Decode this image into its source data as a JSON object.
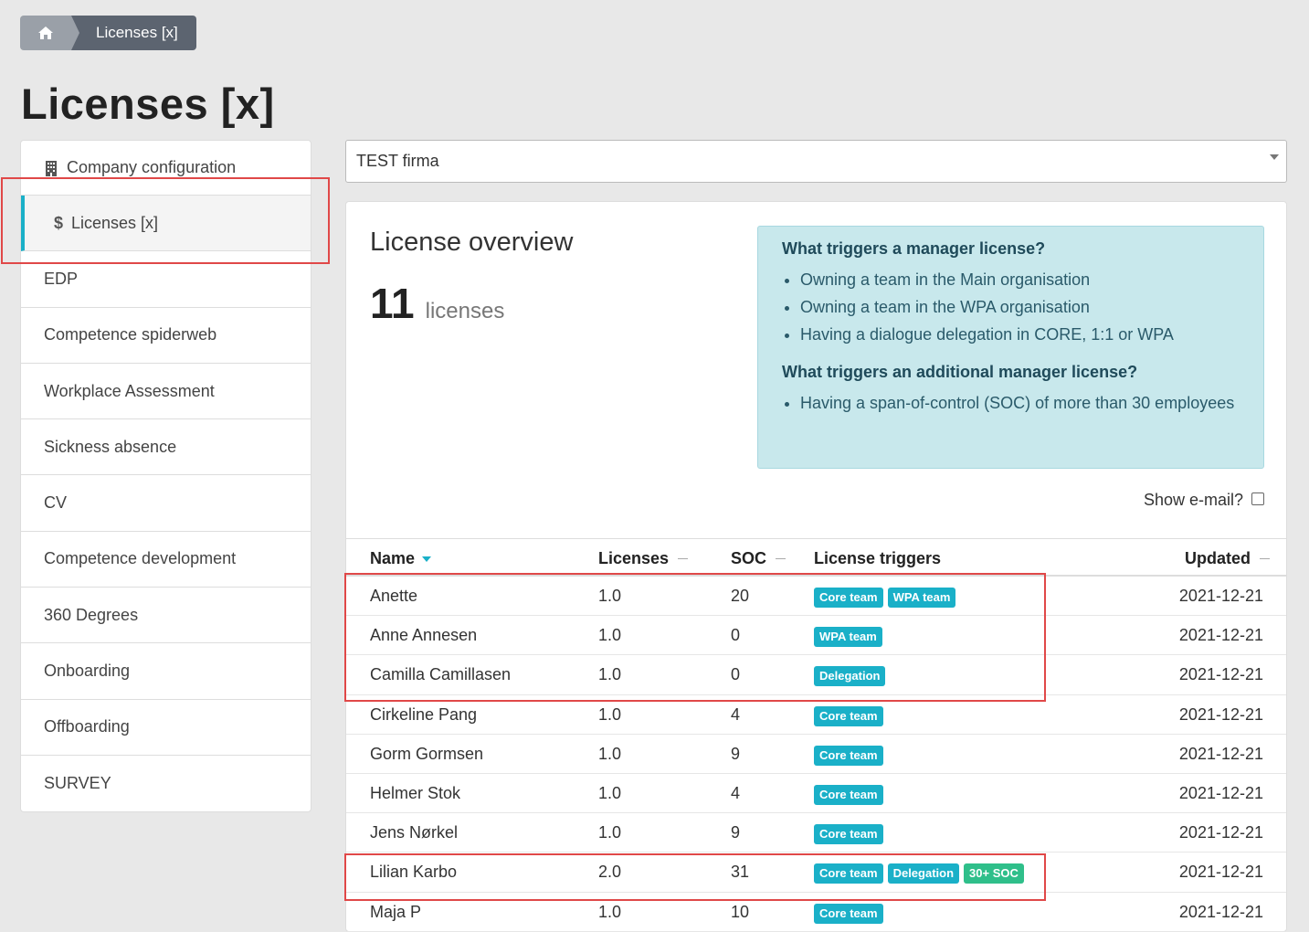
{
  "breadcrumb": {
    "home_icon": "home-icon",
    "current": "Licenses [x]"
  },
  "page_title": "Licenses [x]",
  "sidebar": {
    "items": [
      {
        "label": "Company configuration",
        "icon": "building-icon"
      },
      {
        "label": "Licenses [x]",
        "icon": "dollar-icon",
        "active": true
      },
      {
        "label": "EDP"
      },
      {
        "label": "Competence spiderweb"
      },
      {
        "label": "Workplace Assessment"
      },
      {
        "label": "Sickness absence"
      },
      {
        "label": "CV"
      },
      {
        "label": "Competence development"
      },
      {
        "label": "360 Degrees"
      },
      {
        "label": "Onboarding"
      },
      {
        "label": "Offboarding"
      },
      {
        "label": "SURVEY"
      }
    ]
  },
  "company_select": {
    "value": "TEST firma"
  },
  "overview": {
    "title": "License overview",
    "count": "11",
    "count_label": "licenses"
  },
  "info": {
    "heading1": "What triggers a manager license?",
    "list1": [
      "Owning a team in the Main organisation",
      "Owning a team in the WPA organisation",
      "Having a dialogue delegation in CORE, 1:1 or WPA"
    ],
    "heading2": "What triggers an additional manager license?",
    "list2": [
      "Having a span-of-control (SOC) of more than 30 employees"
    ]
  },
  "show_email": {
    "label": "Show e-mail?",
    "checked": false
  },
  "table": {
    "columns": {
      "name": "Name",
      "licenses": "Licenses",
      "soc": "SOC",
      "triggers": "License triggers",
      "updated": "Updated"
    },
    "rows": [
      {
        "name": "Anette",
        "licenses": "1.0",
        "soc": "20",
        "triggers": [
          "Core team",
          "WPA team"
        ],
        "updated": "2021-12-21"
      },
      {
        "name": "Anne Annesen",
        "licenses": "1.0",
        "soc": "0",
        "triggers": [
          "WPA team"
        ],
        "updated": "2021-12-21"
      },
      {
        "name": "Camilla Camillasen",
        "licenses": "1.0",
        "soc": "0",
        "triggers": [
          "Delegation"
        ],
        "updated": "2021-12-21"
      },
      {
        "name": "Cirkeline Pang",
        "licenses": "1.0",
        "soc": "4",
        "triggers": [
          "Core team"
        ],
        "updated": "2021-12-21"
      },
      {
        "name": "Gorm Gormsen",
        "licenses": "1.0",
        "soc": "9",
        "triggers": [
          "Core team"
        ],
        "updated": "2021-12-21"
      },
      {
        "name": "Helmer Stok",
        "licenses": "1.0",
        "soc": "4",
        "triggers": [
          "Core team"
        ],
        "updated": "2021-12-21"
      },
      {
        "name": "Jens Nørkel",
        "licenses": "1.0",
        "soc": "9",
        "triggers": [
          "Core team"
        ],
        "updated": "2021-12-21"
      },
      {
        "name": "Lilian Karbo",
        "licenses": "2.0",
        "soc": "31",
        "triggers": [
          "Core team",
          "Delegation",
          "30+ SOC"
        ],
        "updated": "2021-12-21"
      },
      {
        "name": "Maja P",
        "licenses": "1.0",
        "soc": "10",
        "triggers": [
          "Core team"
        ],
        "updated": "2021-12-21"
      }
    ]
  },
  "colors": {
    "accent": "#1ab0c8",
    "soc_badge": "#2fbf8a",
    "highlight": "#e04848"
  }
}
